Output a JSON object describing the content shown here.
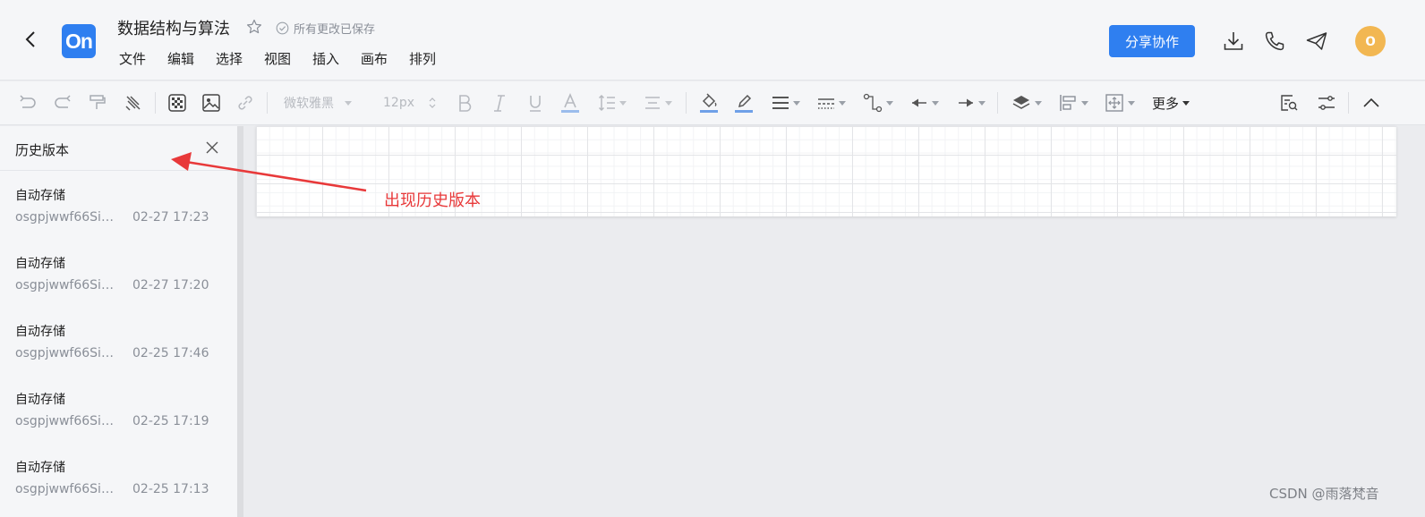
{
  "header": {
    "logo_text": "On",
    "title": "数据结构与算法",
    "save_status": "所有更改已保存",
    "menu": [
      "文件",
      "编辑",
      "选择",
      "视图",
      "插入",
      "画布",
      "排列"
    ],
    "share_label": "分享协作",
    "avatar_letter": "o"
  },
  "toolbar": {
    "font_name": "微软雅黑",
    "font_size": "12px",
    "more_label": "更多"
  },
  "sidebar": {
    "title": "历史版本",
    "versions": [
      {
        "label": "自动存储",
        "user": "osgpjwwf66Sia...",
        "time": "02-27 17:23"
      },
      {
        "label": "自动存储",
        "user": "osgpjwwf66Sia...",
        "time": "02-27 17:20"
      },
      {
        "label": "自动存储",
        "user": "osgpjwwf66Sia...",
        "time": "02-25 17:46"
      },
      {
        "label": "自动存储",
        "user": "osgpjwwf66Sia...",
        "time": "02-25 17:19"
      },
      {
        "label": "自动存储",
        "user": "osgpjwwf66Sia...",
        "time": "02-25 17:13"
      }
    ]
  },
  "annotation": {
    "text": "出现历史版本",
    "color": "#e8393a"
  },
  "watermark": "CSDN @雨落梵音",
  "colors": {
    "brand": "#2f7ff0",
    "avatar": "#f2b752"
  }
}
